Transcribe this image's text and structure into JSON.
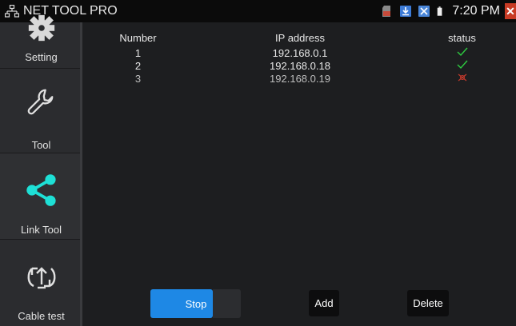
{
  "statusbar": {
    "app_title": "NET TOOL PRO",
    "time": "7:20 PM",
    "icons": [
      "network-icon",
      "sd-card-icon",
      "download-icon",
      "image-icon",
      "battery-icon",
      "close-icon"
    ],
    "close_glyph": "✕"
  },
  "sidebar": {
    "items": [
      {
        "label": "Setting",
        "icon": "gear-icon"
      },
      {
        "label": "Tool",
        "icon": "wrench-icon"
      },
      {
        "label": "Link Tool",
        "icon": "share-icon"
      },
      {
        "label": "Cable test",
        "icon": "cable-test-icon"
      }
    ]
  },
  "table": {
    "headers": {
      "number": "Number",
      "ip": "IP address",
      "status": "status"
    },
    "rows": [
      {
        "number": "1",
        "ip": "192.168.0.1",
        "status": "ok"
      },
      {
        "number": "2",
        "ip": "192.168.0.18",
        "status": "ok"
      },
      {
        "number": "3",
        "ip": "192.168.0.19",
        "status": "fail"
      }
    ]
  },
  "buttons": {
    "stop": "Stop",
    "add": "Add",
    "delete": "Delete"
  },
  "colors": {
    "accent": "#1e88e5",
    "ok": "#2ecc40",
    "fail": "#c0392b",
    "link_tool": "#1ee0d6"
  }
}
